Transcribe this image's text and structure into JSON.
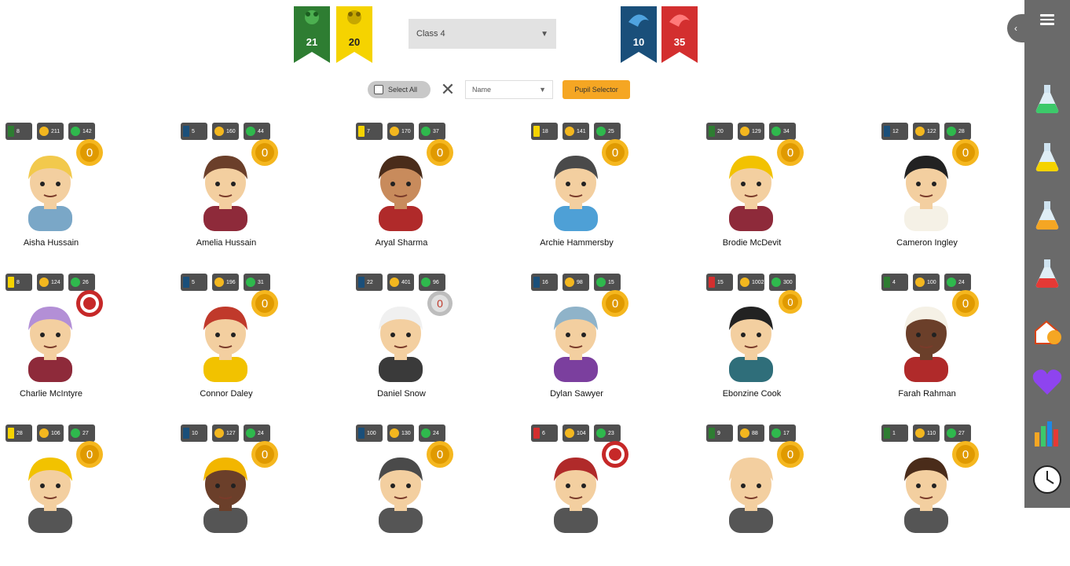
{
  "header": {
    "class_selector": {
      "value": "Class 4"
    },
    "houses": [
      {
        "color": "#2e7d32",
        "points": "21",
        "icon": "frog-icon"
      },
      {
        "color": "#f5d300",
        "points": "20",
        "icon": "frog-icon"
      },
      {
        "color": "#1a4f7a",
        "points": "10",
        "icon": "dragon-icon"
      },
      {
        "color": "#d32f2f",
        "points": "35",
        "icon": "dragon-icon"
      }
    ]
  },
  "toolbar": {
    "select_all_label": "Select All",
    "sort_value": "Name",
    "pupil_selector_label": "Pupil Selector"
  },
  "pupils": [
    {
      "name": "Aisha Hussain",
      "house": "#2e7d32",
      "house_count": "8",
      "coins": "211",
      "points": "142",
      "skin": "#f3cfa0",
      "hair": "#f2c94c",
      "shirt": "#7aa7c7",
      "award": "coin"
    },
    {
      "name": "Amelia Hussain",
      "house": "#1a4f7a",
      "house_count": "5",
      "coins": "160",
      "points": "44",
      "skin": "#f3cfa0",
      "hair": "#6b3f2a",
      "shirt": "#8e2a3a",
      "award": "coin"
    },
    {
      "name": "Aryal Sharma",
      "house": "#f5d300",
      "house_count": "7",
      "coins": "170",
      "points": "37",
      "skin": "#c88b5c",
      "hair": "#4a2c1a",
      "shirt": "#b02a2a",
      "award": "coin"
    },
    {
      "name": "Archie Hammersby",
      "house": "#f5d300",
      "house_count": "18",
      "coins": "141",
      "points": "25",
      "skin": "#f3cfa0",
      "hair": "#4a4a4a",
      "shirt": "#4ea0d6",
      "award": "coin"
    },
    {
      "name": "Brodie McDevit",
      "house": "#2e7d32",
      "house_count": "20",
      "coins": "129",
      "points": "34",
      "skin": "#f3cfa0",
      "hair": "#f2c200",
      "shirt": "#8e2a3a",
      "award": "coin"
    },
    {
      "name": "Cameron Ingley",
      "house": "#1a4f7a",
      "house_count": "12",
      "coins": "122",
      "points": "28",
      "skin": "#f3cfa0",
      "hair": "#222222",
      "shirt": "#f5f1e6",
      "award": "coin"
    },
    {
      "name": "Charlie McIntyre",
      "house": "#f5d300",
      "house_count": "8",
      "coins": "124",
      "points": "26",
      "skin": "#f3cfa0",
      "hair": "#b38fd6",
      "shirt": "#8e2a3a",
      "award": "seal"
    },
    {
      "name": "Connor Daley",
      "house": "#1a4f7a",
      "house_count": "5",
      "coins": "196",
      "points": "31",
      "skin": "#f3cfa0",
      "hair": "#c0392b",
      "shirt": "#f2c200",
      "award": "coin"
    },
    {
      "name": "Daniel Snow",
      "house": "#1a4f7a",
      "house_count": "22",
      "coins": "401",
      "points": "96",
      "skin": "#f3cfa0",
      "hair": "#f0f0f0",
      "shirt": "#3a3a3a",
      "award": "silver"
    },
    {
      "name": "Dylan Sawyer",
      "house": "#1a4f7a",
      "house_count": "16",
      "coins": "98",
      "points": "15",
      "skin": "#f3cfa0",
      "hair": "#8fb3c9",
      "shirt": "#7b3f9e",
      "award": "coin"
    },
    {
      "name": "Ebonzine Cook",
      "house": "#d32f2f",
      "house_count": "15",
      "coins": "1002",
      "points": "300",
      "skin": "#f3cfa0",
      "hair": "#222222",
      "shirt": "#2f6e7a",
      "award": "medal"
    },
    {
      "name": "Farah Rahman",
      "house": "#2e7d32",
      "house_count": "4",
      "coins": "100",
      "points": "24",
      "skin": "#6b3f2a",
      "hair": "#f5f1e6",
      "shirt": "#b02a2a",
      "award": "coin"
    },
    {
      "name": "",
      "house": "#f5d300",
      "house_count": "28",
      "coins": "106",
      "points": "27",
      "skin": "#f3cfa0",
      "hair": "#f2c200",
      "shirt": "#555555",
      "award": "coin"
    },
    {
      "name": "",
      "house": "#1a4f7a",
      "house_count": "10",
      "coins": "127",
      "points": "24",
      "skin": "#6b3f2a",
      "hair": "#f2b600",
      "shirt": "#555555",
      "award": "coin"
    },
    {
      "name": "",
      "house": "#1a4f7a",
      "house_count": "100",
      "coins": "130",
      "points": "24",
      "skin": "#f3cfa0",
      "hair": "#4a4a4a",
      "shirt": "#555555",
      "award": "coin"
    },
    {
      "name": "",
      "house": "#d32f2f",
      "house_count": "6",
      "coins": "104",
      "points": "23",
      "skin": "#f3cfa0",
      "hair": "#b02a2a",
      "shirt": "#555555",
      "award": "seal"
    },
    {
      "name": "",
      "house": "#2e7d32",
      "house_count": "9",
      "coins": "88",
      "points": "17",
      "skin": "#f3cfa0",
      "hair": "#f3cfa0",
      "shirt": "#555555",
      "award": "coin"
    },
    {
      "name": "",
      "house": "#2e7d32",
      "house_count": "1",
      "coins": "110",
      "points": "27",
      "skin": "#f3cfa0",
      "hair": "#4a2c1a",
      "shirt": "#555555",
      "award": "coin"
    }
  ],
  "sidebar": {
    "items": [
      {
        "icon": "green-flask-icon",
        "color": "#3cc96a"
      },
      {
        "icon": "yellow-flask-icon",
        "color": "#f5d300"
      },
      {
        "icon": "orange-flask-icon",
        "color": "#f5a623"
      },
      {
        "icon": "red-flask-icon",
        "color": "#e53935"
      },
      {
        "icon": "house-coin-icon",
        "color": "#f5a623"
      },
      {
        "icon": "heart-icon",
        "color": "#8e44ef"
      },
      {
        "icon": "bar-chart-icon",
        "color": "#e53935"
      },
      {
        "icon": "clock-icon",
        "color": "#ffffff"
      }
    ]
  }
}
